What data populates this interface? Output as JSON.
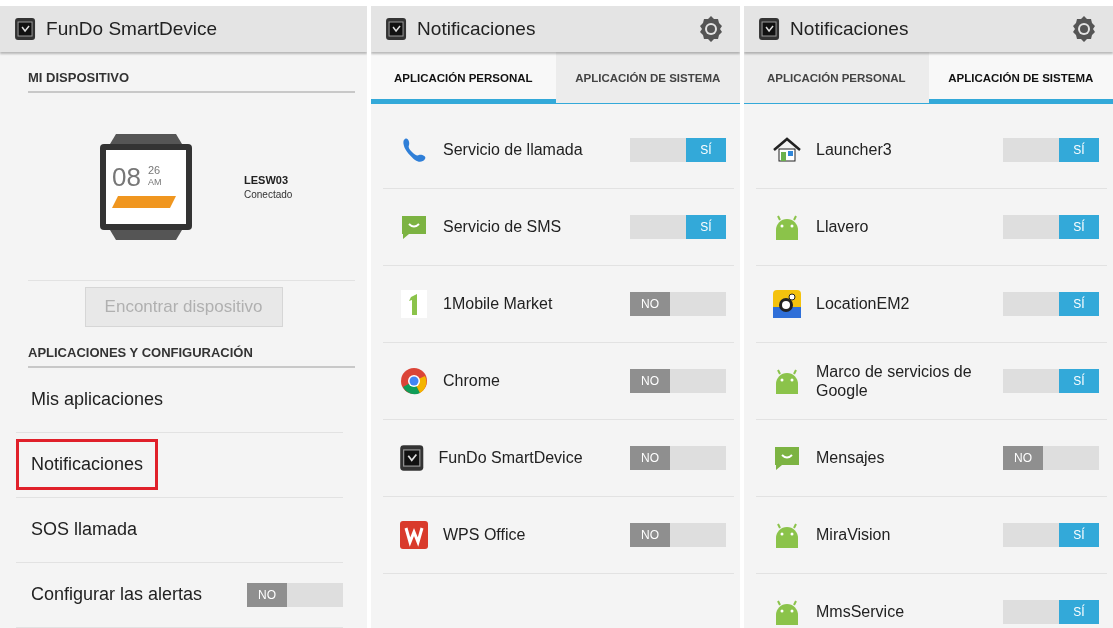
{
  "screens": [
    {
      "kind": "home",
      "title": "FunDo SmartDevice",
      "device_header": "MI DISPOSITIVO",
      "watch": {
        "hour": "08",
        "minute": "26",
        "ampm": "AM"
      },
      "device_name": "LESW03",
      "device_status": "Conectado",
      "find_button": {
        "label": "Encontrar dispositivo",
        "disabled": true
      },
      "apps_header": "APLICACIONES Y CONFIGURACIÓN",
      "menu": [
        {
          "kind": "link",
          "label": "Mis aplicaciones",
          "highlighted": false
        },
        {
          "kind": "link",
          "label": "Notificaciones",
          "highlighted": true
        },
        {
          "kind": "link",
          "label": "SOS llamada",
          "highlighted": false
        },
        {
          "kind": "toggle",
          "label": "Configurar las alertas",
          "highlighted": false,
          "on": false,
          "toggle_label": "NO"
        }
      ]
    },
    {
      "kind": "list",
      "title": "Notificaciones",
      "tabs": [
        {
          "label": "APLICACIÓN PERSONAL",
          "selected": true
        },
        {
          "label": "APLICACIÓN DE SISTEMA",
          "selected": false
        }
      ],
      "apps": [
        {
          "name": "Servicio de llamada",
          "kind": "phone",
          "on": true,
          "toggle_label": "SÍ"
        },
        {
          "name": "Servicio de SMS",
          "kind": "sms",
          "on": true,
          "toggle_label": "SÍ"
        },
        {
          "name": "1Mobile Market",
          "kind": "one",
          "on": false,
          "toggle_label": "NO"
        },
        {
          "name": "Chrome",
          "kind": "chrome",
          "on": false,
          "toggle_label": "NO"
        },
        {
          "name": "FunDo SmartDevice",
          "kind": "watch",
          "on": false,
          "toggle_label": "NO"
        },
        {
          "name": "WPS Office",
          "kind": "wps",
          "on": false,
          "toggle_label": "NO"
        }
      ]
    },
    {
      "kind": "list",
      "title": "Notificaciones",
      "tabs": [
        {
          "label": "APLICACIÓN PERSONAL",
          "selected": false
        },
        {
          "label": "APLICACIÓN DE SISTEMA",
          "selected": true
        }
      ],
      "apps": [
        {
          "name": "Launcher3",
          "kind": "house",
          "on": true,
          "toggle_label": "SÍ"
        },
        {
          "name": "Llavero",
          "kind": "android",
          "on": true,
          "toggle_label": "SÍ"
        },
        {
          "name": "LocationEM2",
          "kind": "bee",
          "on": true,
          "toggle_label": "SÍ"
        },
        {
          "name": "Marco de servicios de Google",
          "kind": "android",
          "on": true,
          "toggle_label": "SÍ"
        },
        {
          "name": "Mensajes",
          "kind": "sms",
          "on": false,
          "toggle_label": "NO"
        },
        {
          "name": "MiraVision",
          "kind": "android",
          "on": true,
          "toggle_label": "SÍ"
        },
        {
          "name": "MmsService",
          "kind": "android",
          "on": true,
          "toggle_label": "SÍ"
        }
      ]
    }
  ]
}
